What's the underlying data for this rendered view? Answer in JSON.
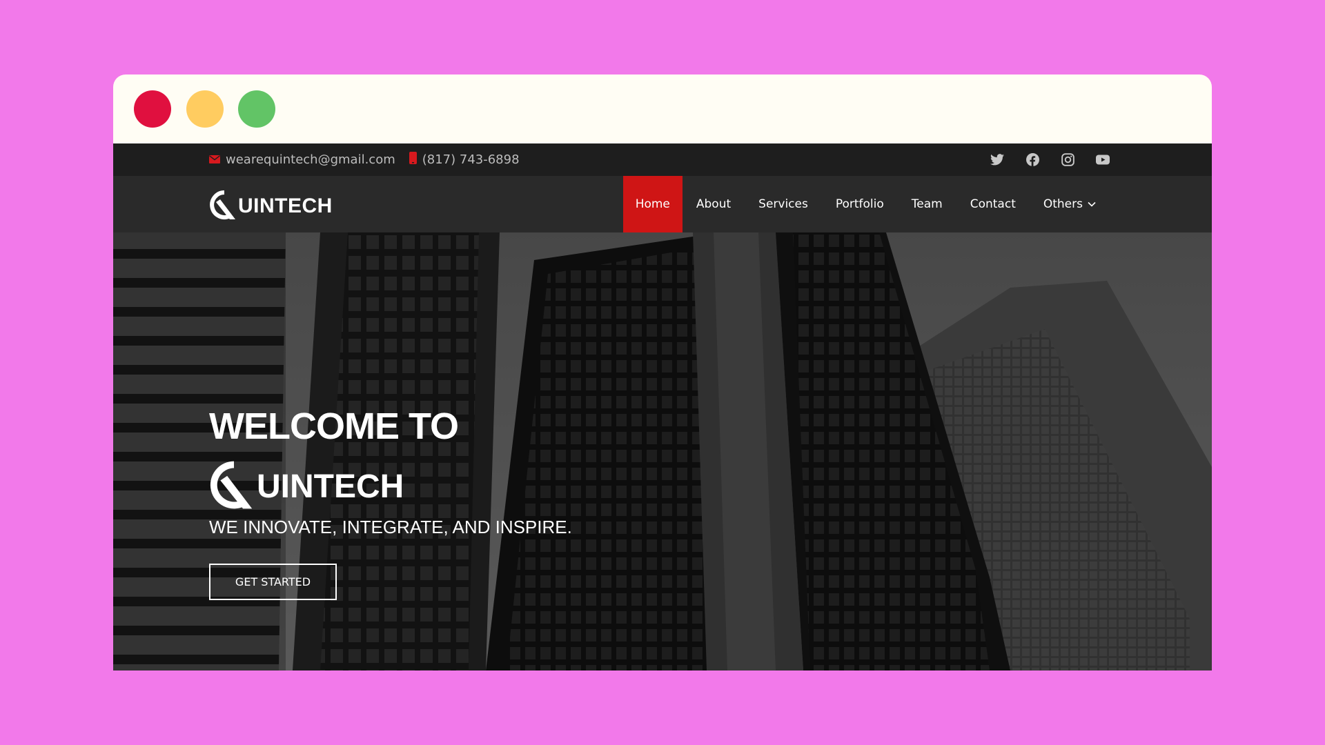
{
  "window": {
    "controls": [
      {
        "name": "close",
        "color": "#e0103f"
      },
      {
        "name": "minimize",
        "color": "#ffcc60"
      },
      {
        "name": "maximize",
        "color": "#62c466"
      }
    ]
  },
  "topbar": {
    "email": "wearequintech@gmail.com",
    "phone": "(817) 743-6898",
    "socials": [
      "twitter-icon",
      "facebook-icon",
      "instagram-icon",
      "youtube-icon"
    ]
  },
  "navbar": {
    "logo_text": "UINTECH",
    "menu": [
      {
        "label": "Home",
        "active": true
      },
      {
        "label": "About"
      },
      {
        "label": "Services"
      },
      {
        "label": "Portfolio"
      },
      {
        "label": "Team"
      },
      {
        "label": "Contact"
      },
      {
        "label": "Others",
        "dropdown": true
      }
    ]
  },
  "hero": {
    "title": "WELCOME TO",
    "logo_text": "UINTECH",
    "tagline": "WE INNOVATE, INTEGRATE, AND INSPIRE.",
    "cta_label": "GET STARTED"
  },
  "colors": {
    "accent": "#cf1515",
    "background": "#f279ea",
    "topbar": "#1e1e1e",
    "navbar": "#2a2a2a"
  }
}
